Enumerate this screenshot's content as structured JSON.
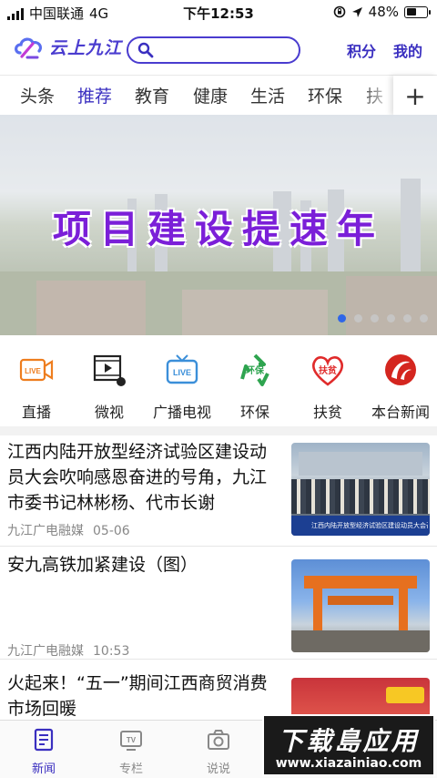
{
  "status_bar": {
    "carrier": "中国联通",
    "network": "4G",
    "time": "下午12:53",
    "battery": "48%",
    "battery_level": 0.48
  },
  "header": {
    "brand": "云上九江",
    "search_placeholder": "",
    "points": "积分",
    "mine": "我的"
  },
  "tabs": {
    "items": [
      "头条",
      "推荐",
      "教育",
      "健康",
      "生活",
      "环保",
      "扶"
    ],
    "active": "推荐",
    "add": "+"
  },
  "banner": {
    "title": "项目建设提速年",
    "slide_count": 6,
    "current_slide": 1
  },
  "quick_links": [
    {
      "label": "直播",
      "icon": "live-camera-icon",
      "badge": "LIVE",
      "color": "#ee7d1e"
    },
    {
      "label": "微视",
      "icon": "video-play-icon",
      "color": "#222222"
    },
    {
      "label": "广播电视",
      "icon": "tv-icon",
      "badge": "LIVE",
      "color": "#3b8fd9"
    },
    {
      "label": "环保",
      "icon": "recycle-icon",
      "badge": "环保",
      "color": "#2ea44f"
    },
    {
      "label": "扶贫",
      "icon": "heart-icon",
      "badge": "扶贫",
      "color": "#e02b2b"
    },
    {
      "label": "本台新闻",
      "icon": "station-logo-icon",
      "color": "#d4261f"
    }
  ],
  "news": [
    {
      "title": "江西内陆开放型经济试验区建设动员大会吹响感恩奋进的号角，九江市委书记林彬杨、代市长谢",
      "source": "九江广电融媒",
      "time": "05-06",
      "thumb_caption": "江西内陆开放型经济试验区建设动员大会召开"
    },
    {
      "title": "安九高铁加紧建设（图）",
      "source": "九江广电融媒",
      "time": "10:53",
      "thumb_caption": ""
    },
    {
      "title": "火起来！“五一”期间江西商贸消费市场回暖",
      "source": "",
      "time": "",
      "thumb_caption": ""
    }
  ],
  "bottom_nav": [
    {
      "label": "新闻",
      "icon": "news-icon",
      "active": true
    },
    {
      "label": "专栏",
      "icon": "tv-column-icon",
      "active": false
    },
    {
      "label": "说说",
      "icon": "camera-icon",
      "active": false
    }
  ],
  "watermark": {
    "line1": "下载島应用",
    "line2": "www.xiazainiao.com"
  }
}
